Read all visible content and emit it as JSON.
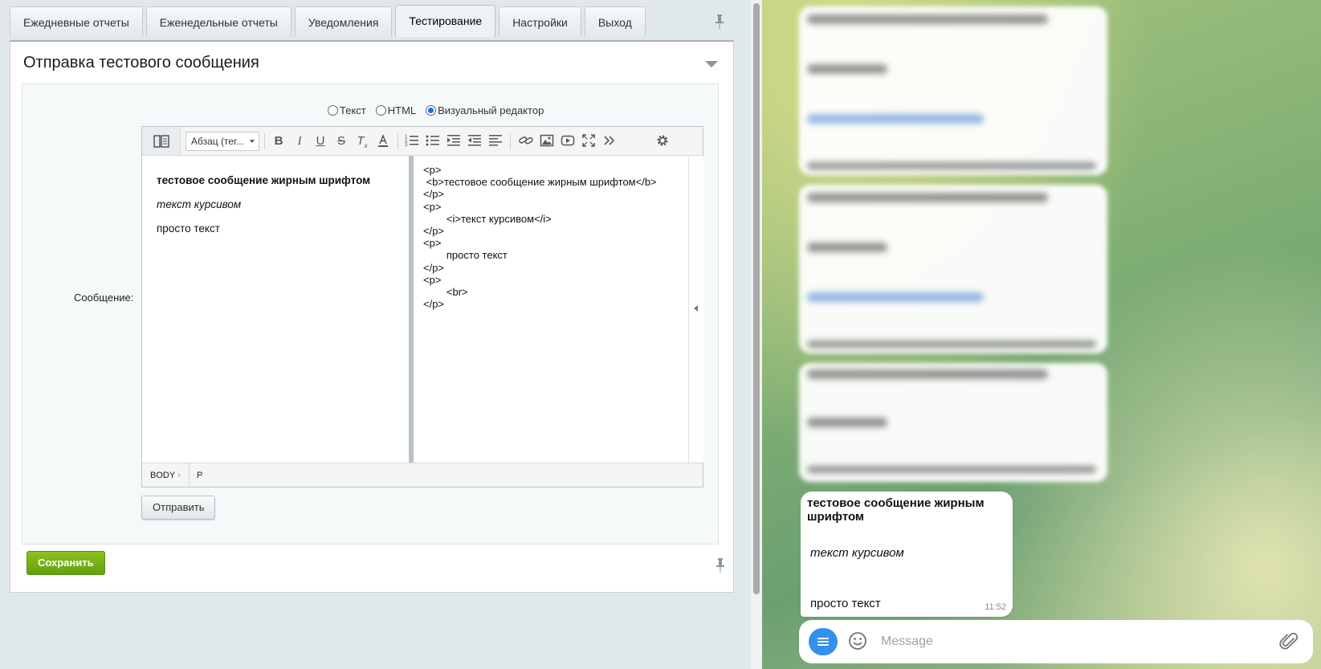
{
  "admin": {
    "tabs": [
      {
        "label": "Ежедневные отчеты"
      },
      {
        "label": "Еженедельные отчеты"
      },
      {
        "label": "Уведомления"
      },
      {
        "label": "Тестирование"
      },
      {
        "label": "Настройки"
      },
      {
        "label": "Выход"
      }
    ],
    "active_tab": "Тестирование",
    "section_title": "Отправка тестового сообщения",
    "format_options": [
      {
        "label": "Текст",
        "checked": false
      },
      {
        "label": "HTML",
        "checked": false
      },
      {
        "label": "Визуальный редактор",
        "checked": true
      }
    ],
    "message_label": "Сообщение:",
    "editor": {
      "paragraph_select": "Абзац (тег...",
      "toolbar_icons": [
        "mode-toggle-icon",
        "bold-icon",
        "italic-icon",
        "underline-icon",
        "strikethrough-icon",
        "clear-format-icon",
        "text-color-icon",
        "ordered-list-icon",
        "unordered-list-icon",
        "indent-icon",
        "outdent-icon",
        "align-icon",
        "link-icon",
        "image-icon",
        "video-icon",
        "fullscreen-icon",
        "more-icon",
        "settings-icon"
      ],
      "visual": {
        "bold_line": "тестовое сообщение жирным шрифтом",
        "italic_line": "текст курсивом",
        "plain_line": "просто текст"
      },
      "source_lines": [
        "<p>",
        " <b>тестовое сообщение жирным шрифтом</b>",
        "</p>",
        "<p>",
        "        <i>текст курсивом</i>",
        "</p>",
        "<p>",
        "        просто текст",
        "</p>",
        "<p>",
        "        <br>",
        "</p>"
      ],
      "status": {
        "body": "BODY",
        "sep": "›",
        "p": "P"
      }
    },
    "send_label": "Отправить",
    "save_label": "Сохранить"
  },
  "telegram": {
    "message": {
      "bold_line": "тестовое сообщение жирным шрифтом",
      "italic_line": "текст курсивом",
      "plain_line": "просто текст",
      "time": "11:52"
    },
    "composer_placeholder": "Message"
  },
  "colors": {
    "accent_green": "#6aaa12",
    "telegram_blue": "#3390ec",
    "link_blue": "#3b7bd6"
  }
}
